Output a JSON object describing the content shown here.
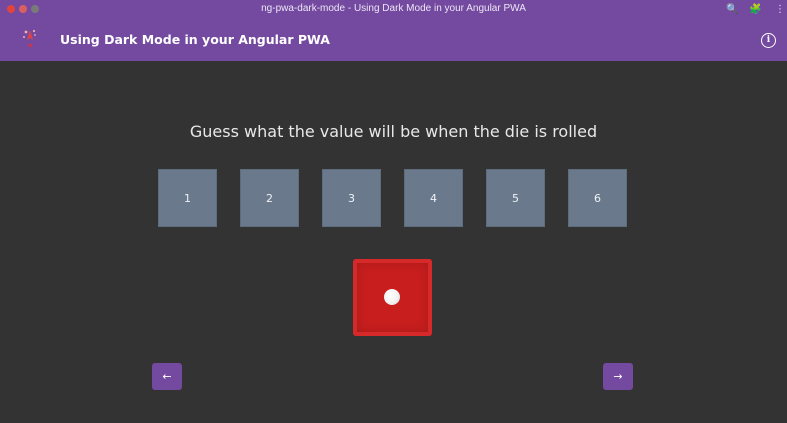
{
  "window": {
    "title": "ng-pwa-dark-mode - Using Dark Mode in your Angular PWA",
    "icons": {
      "search": "🔍",
      "extensions": "🧩",
      "more": "⋮"
    }
  },
  "appbar": {
    "title": "Using Dark Mode in your Angular PWA",
    "info_icon": "i"
  },
  "game": {
    "question": "Guess what the value will be when the die is rolled",
    "options": [
      "1",
      "2",
      "3",
      "4",
      "5",
      "6"
    ],
    "die_value": 1
  },
  "nav": {
    "prev_icon": "←",
    "next_icon": "→"
  },
  "colors": {
    "accent": "#744aa1",
    "background": "#333333",
    "tile": "#6a7a8c",
    "die": "#c81e1e"
  }
}
